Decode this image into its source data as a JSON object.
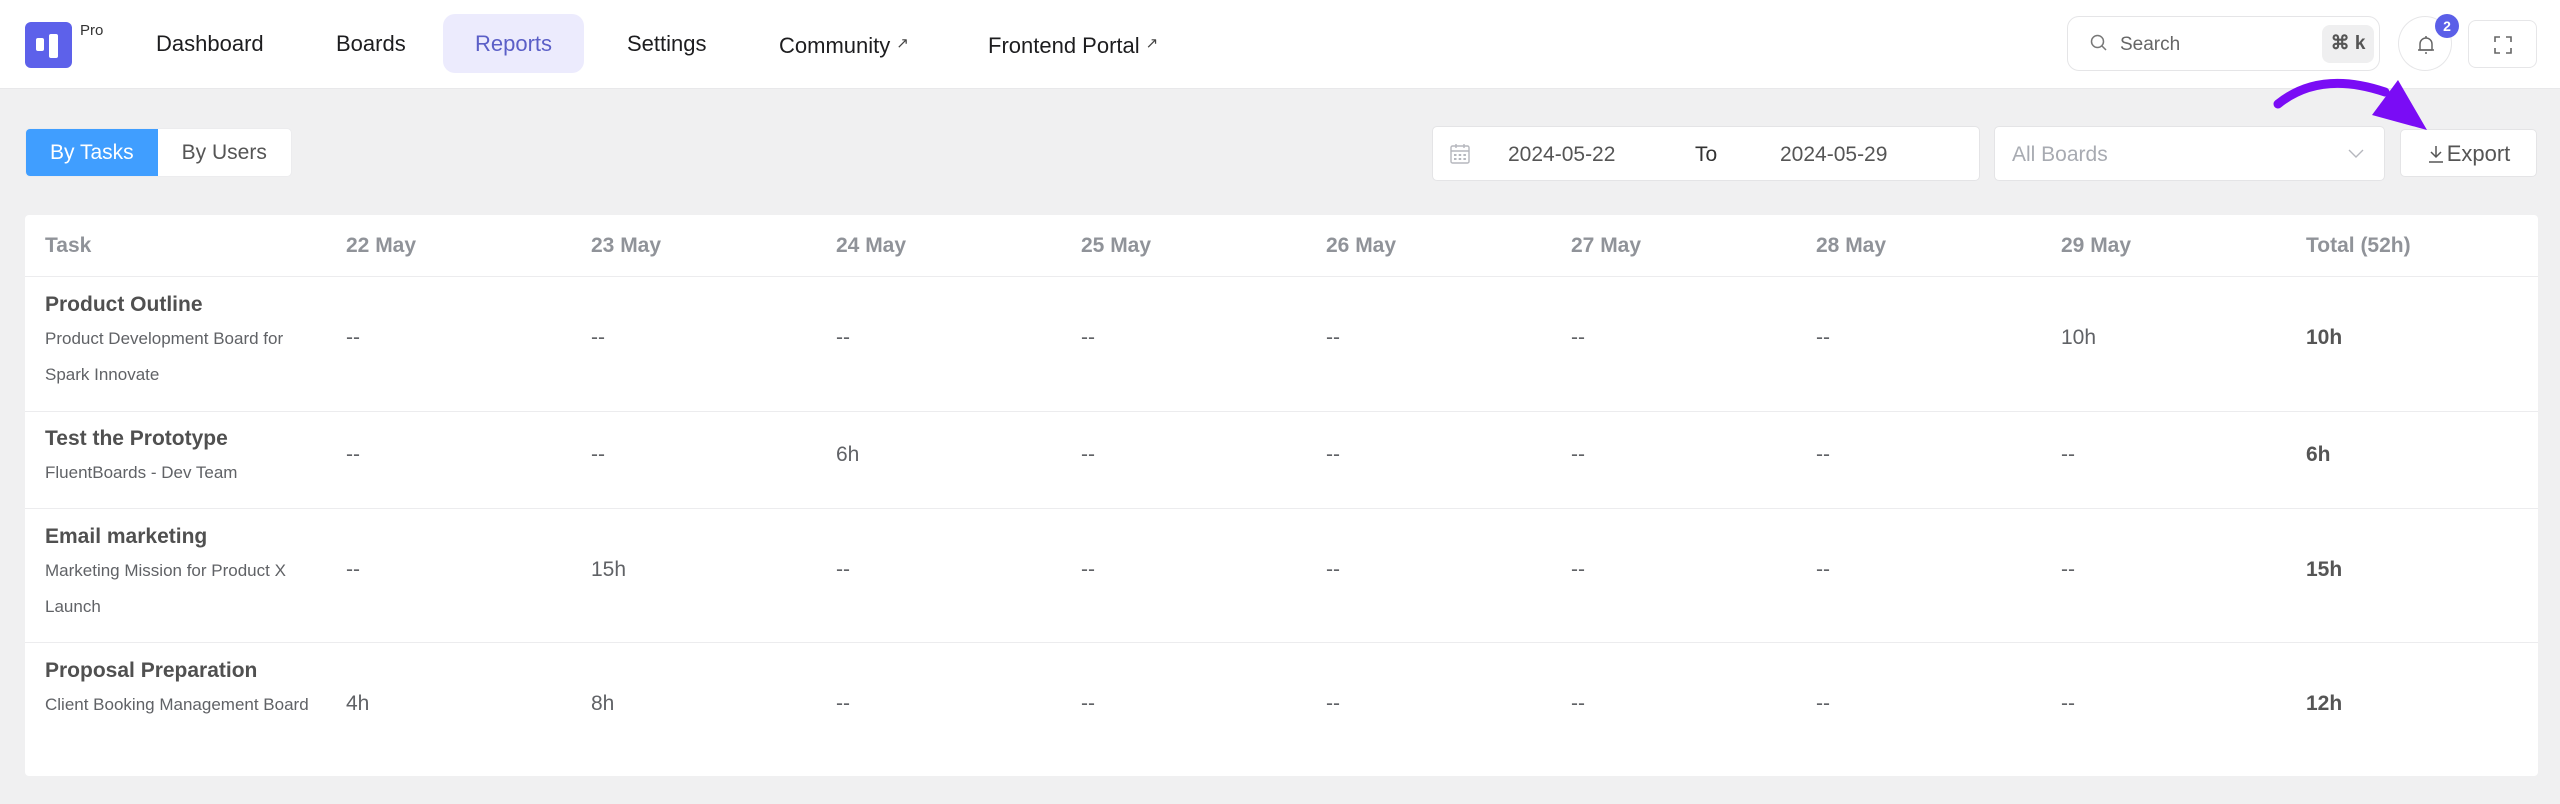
{
  "header": {
    "logo_badge": "Pro",
    "nav": [
      {
        "label": "Dashboard",
        "external": false,
        "active": false
      },
      {
        "label": "Boards",
        "external": false,
        "active": false
      },
      {
        "label": "Reports",
        "external": false,
        "active": true
      },
      {
        "label": "Settings",
        "external": false,
        "active": false
      },
      {
        "label": "Community",
        "external": true,
        "active": false
      },
      {
        "label": "Frontend Portal",
        "external": true,
        "active": false
      }
    ],
    "external_icon": "↗",
    "search": {
      "placeholder": "Search",
      "shortcut": "⌘ k"
    },
    "notifications_count": "2"
  },
  "toolbar": {
    "view_tabs": [
      {
        "label": "By Tasks",
        "active": true
      },
      {
        "label": "By Users",
        "active": false
      }
    ],
    "date_from": "2024-05-22",
    "date_separator": "To",
    "date_to": "2024-05-29",
    "boards_placeholder": "All Boards",
    "export_label": "Export"
  },
  "colors": {
    "brand": "#5d61ea",
    "active_tab": "#409eff",
    "annotation_arrow": "#7a0cf5"
  },
  "table": {
    "columns": [
      "Task",
      "22 May",
      "23 May",
      "24 May",
      "25 May",
      "26 May",
      "27 May",
      "28 May",
      "29 May",
      "Total (52h)"
    ],
    "rows": [
      {
        "task": "Product Outline",
        "board": "Product Development Board for Spark Innovate",
        "values": [
          "--",
          "--",
          "--",
          "--",
          "--",
          "--",
          "--",
          "10h"
        ],
        "total": "10h"
      },
      {
        "task": "Test the Prototype",
        "board": "FluentBoards - Dev Team",
        "values": [
          "--",
          "--",
          "6h",
          "--",
          "--",
          "--",
          "--",
          "--"
        ],
        "total": "6h"
      },
      {
        "task": "Email marketing",
        "board": "Marketing Mission for Product X Launch",
        "values": [
          "--",
          "15h",
          "--",
          "--",
          "--",
          "--",
          "--",
          "--"
        ],
        "total": "15h"
      },
      {
        "task": "Proposal Preparation",
        "board": "Client Booking Management Board",
        "values": [
          "4h",
          "8h",
          "--",
          "--",
          "--",
          "--",
          "--",
          "--"
        ],
        "total": "12h"
      }
    ]
  }
}
